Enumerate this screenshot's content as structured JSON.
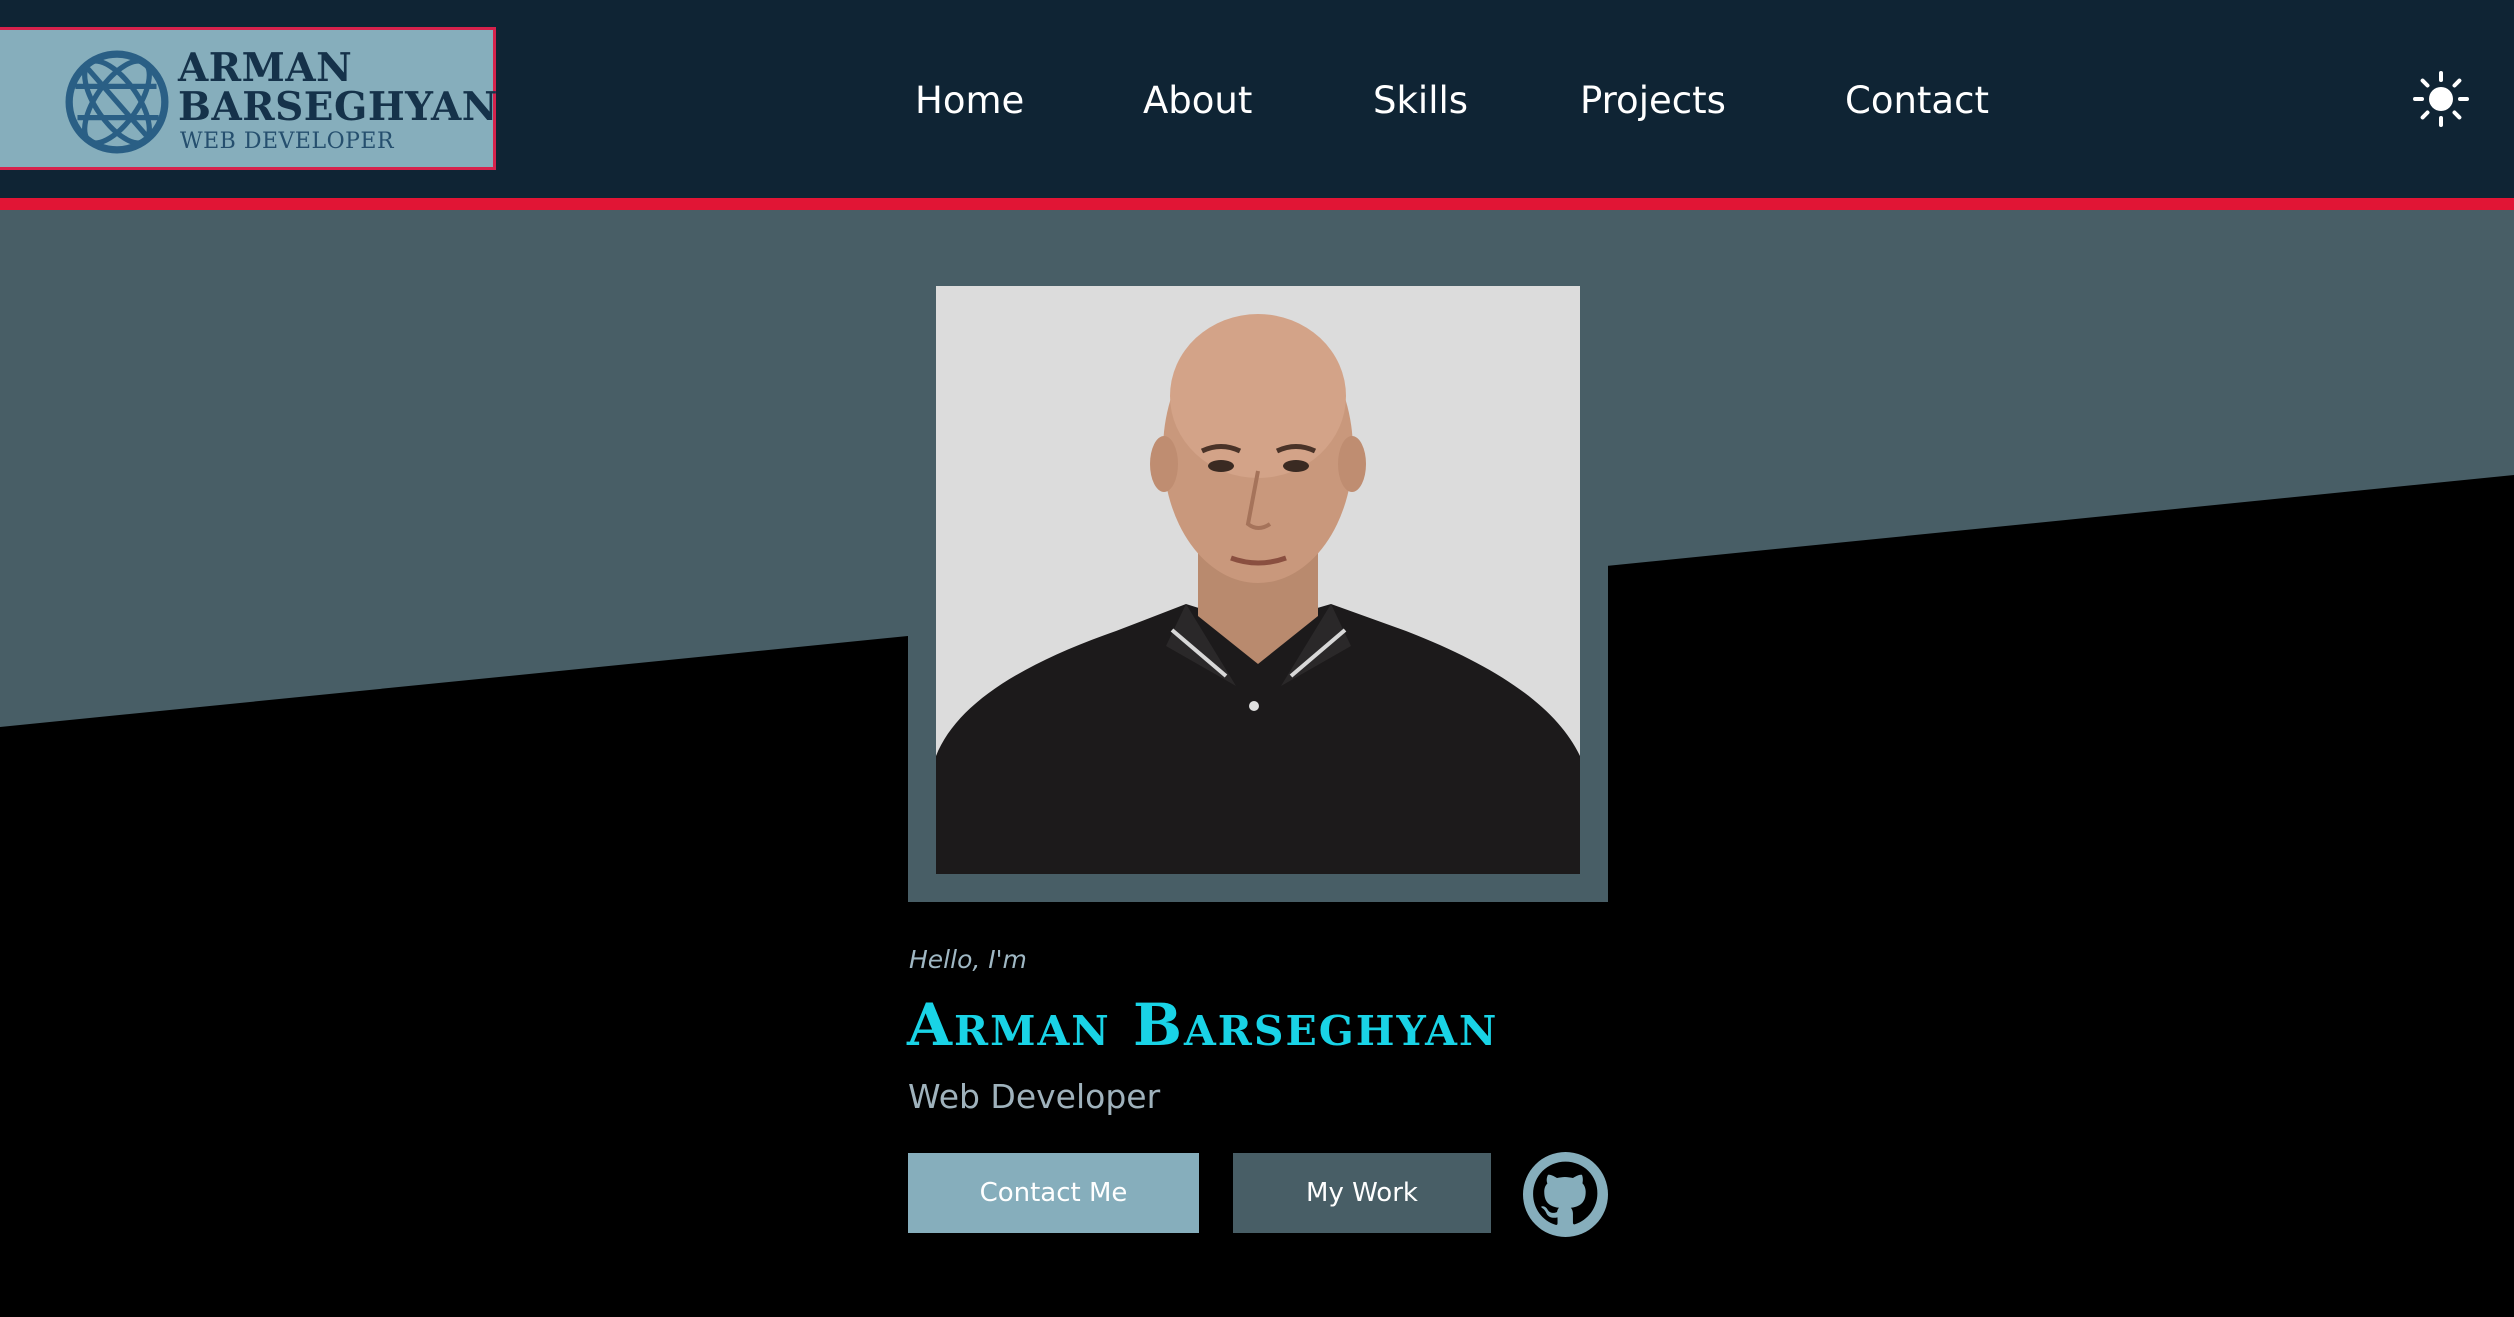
{
  "logo": {
    "line1": "ARMAN",
    "line2": "BARSEGHYAN",
    "subtitle": "WEB DEVELOPER"
  },
  "nav": {
    "items": [
      {
        "label": "Home"
      },
      {
        "label": "About"
      },
      {
        "label": "Skills"
      },
      {
        "label": "Projects"
      },
      {
        "label": "Contact"
      }
    ]
  },
  "theme_toggle": {
    "icon": "sun-icon"
  },
  "hero": {
    "greeting": "Hello, I'm",
    "name": "Arman Barseghyan",
    "role": "Web Developer",
    "photo_icon": "profile-photo",
    "buttons": {
      "contact": "Contact Me",
      "work": "My Work"
    },
    "github_icon": "github-icon"
  },
  "colors": {
    "header_bg": "#0f2434",
    "accent_stripe": "#e11535",
    "slate": "#485e66",
    "light_blue": "#86aebc",
    "name_cyan": "#19d3e6",
    "background": "#000000"
  }
}
